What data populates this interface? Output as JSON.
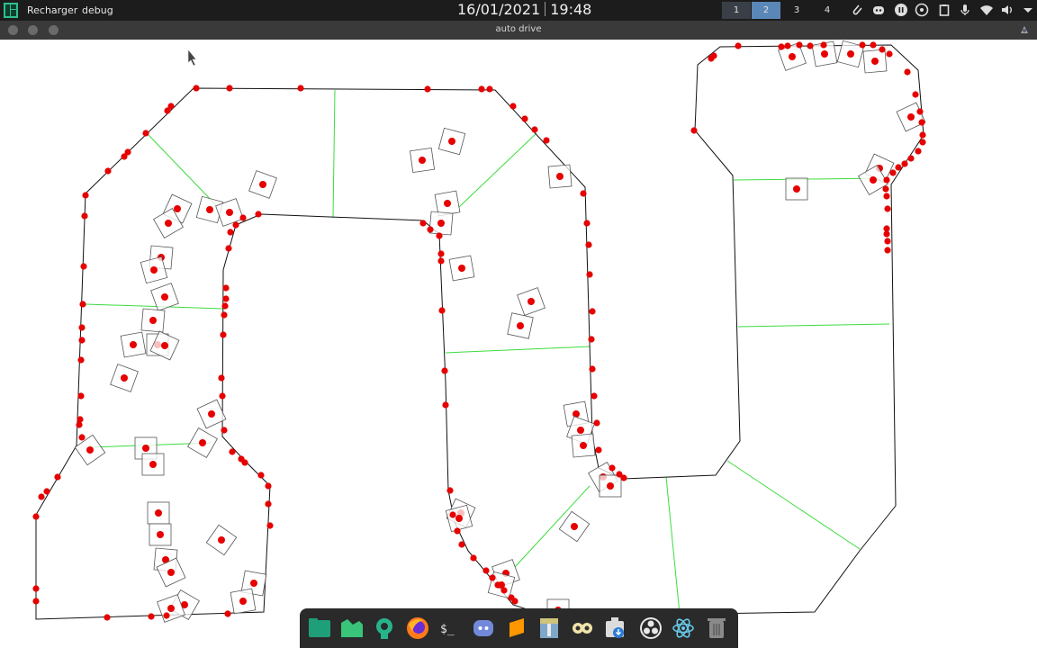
{
  "topbar": {
    "menu": [
      "Recharger",
      "debug"
    ],
    "date": "16/01/2021",
    "time": "19:48",
    "workspaces": [
      "1",
      "2",
      "3",
      "4"
    ],
    "active_workspace": "2"
  },
  "window": {
    "title": "auto drive"
  },
  "colors": {
    "track": "#111111",
    "checkpoint": "#3ddc3d",
    "car_dot": "#e60000",
    "topbar_bg": "#1c1c1c",
    "active_ws": "#5a87b8"
  },
  "dock": {
    "apps": [
      "files-icon",
      "folder-icon",
      "manjaro-settings-icon",
      "firefox-icon",
      "terminal-icon",
      "discord-icon",
      "sublime-icon",
      "archive-icon",
      "rss-icon",
      "downloader-icon",
      "obs-icon",
      "atom-icon",
      "trash-icon"
    ]
  }
}
